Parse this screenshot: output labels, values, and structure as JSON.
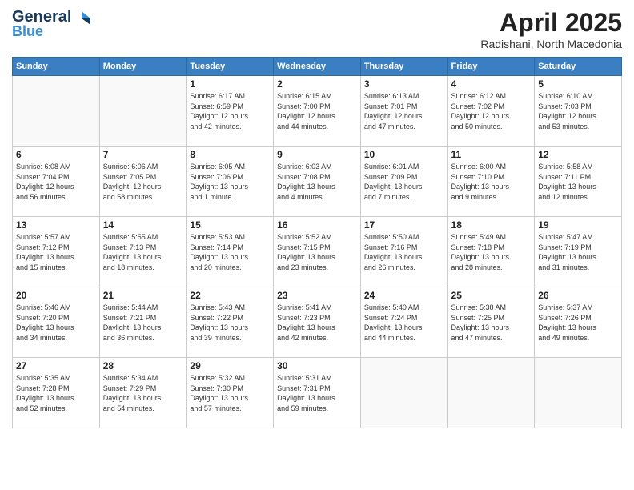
{
  "header": {
    "logo_general": "General",
    "logo_blue": "Blue",
    "month_title": "April 2025",
    "location": "Radishani, North Macedonia"
  },
  "weekdays": [
    "Sunday",
    "Monday",
    "Tuesday",
    "Wednesday",
    "Thursday",
    "Friday",
    "Saturday"
  ],
  "weeks": [
    [
      {
        "day": "",
        "info": ""
      },
      {
        "day": "",
        "info": ""
      },
      {
        "day": "1",
        "info": "Sunrise: 6:17 AM\nSunset: 6:59 PM\nDaylight: 12 hours\nand 42 minutes."
      },
      {
        "day": "2",
        "info": "Sunrise: 6:15 AM\nSunset: 7:00 PM\nDaylight: 12 hours\nand 44 minutes."
      },
      {
        "day": "3",
        "info": "Sunrise: 6:13 AM\nSunset: 7:01 PM\nDaylight: 12 hours\nand 47 minutes."
      },
      {
        "day": "4",
        "info": "Sunrise: 6:12 AM\nSunset: 7:02 PM\nDaylight: 12 hours\nand 50 minutes."
      },
      {
        "day": "5",
        "info": "Sunrise: 6:10 AM\nSunset: 7:03 PM\nDaylight: 12 hours\nand 53 minutes."
      }
    ],
    [
      {
        "day": "6",
        "info": "Sunrise: 6:08 AM\nSunset: 7:04 PM\nDaylight: 12 hours\nand 56 minutes."
      },
      {
        "day": "7",
        "info": "Sunrise: 6:06 AM\nSunset: 7:05 PM\nDaylight: 12 hours\nand 58 minutes."
      },
      {
        "day": "8",
        "info": "Sunrise: 6:05 AM\nSunset: 7:06 PM\nDaylight: 13 hours\nand 1 minute."
      },
      {
        "day": "9",
        "info": "Sunrise: 6:03 AM\nSunset: 7:08 PM\nDaylight: 13 hours\nand 4 minutes."
      },
      {
        "day": "10",
        "info": "Sunrise: 6:01 AM\nSunset: 7:09 PM\nDaylight: 13 hours\nand 7 minutes."
      },
      {
        "day": "11",
        "info": "Sunrise: 6:00 AM\nSunset: 7:10 PM\nDaylight: 13 hours\nand 9 minutes."
      },
      {
        "day": "12",
        "info": "Sunrise: 5:58 AM\nSunset: 7:11 PM\nDaylight: 13 hours\nand 12 minutes."
      }
    ],
    [
      {
        "day": "13",
        "info": "Sunrise: 5:57 AM\nSunset: 7:12 PM\nDaylight: 13 hours\nand 15 minutes."
      },
      {
        "day": "14",
        "info": "Sunrise: 5:55 AM\nSunset: 7:13 PM\nDaylight: 13 hours\nand 18 minutes."
      },
      {
        "day": "15",
        "info": "Sunrise: 5:53 AM\nSunset: 7:14 PM\nDaylight: 13 hours\nand 20 minutes."
      },
      {
        "day": "16",
        "info": "Sunrise: 5:52 AM\nSunset: 7:15 PM\nDaylight: 13 hours\nand 23 minutes."
      },
      {
        "day": "17",
        "info": "Sunrise: 5:50 AM\nSunset: 7:16 PM\nDaylight: 13 hours\nand 26 minutes."
      },
      {
        "day": "18",
        "info": "Sunrise: 5:49 AM\nSunset: 7:18 PM\nDaylight: 13 hours\nand 28 minutes."
      },
      {
        "day": "19",
        "info": "Sunrise: 5:47 AM\nSunset: 7:19 PM\nDaylight: 13 hours\nand 31 minutes."
      }
    ],
    [
      {
        "day": "20",
        "info": "Sunrise: 5:46 AM\nSunset: 7:20 PM\nDaylight: 13 hours\nand 34 minutes."
      },
      {
        "day": "21",
        "info": "Sunrise: 5:44 AM\nSunset: 7:21 PM\nDaylight: 13 hours\nand 36 minutes."
      },
      {
        "day": "22",
        "info": "Sunrise: 5:43 AM\nSunset: 7:22 PM\nDaylight: 13 hours\nand 39 minutes."
      },
      {
        "day": "23",
        "info": "Sunrise: 5:41 AM\nSunset: 7:23 PM\nDaylight: 13 hours\nand 42 minutes."
      },
      {
        "day": "24",
        "info": "Sunrise: 5:40 AM\nSunset: 7:24 PM\nDaylight: 13 hours\nand 44 minutes."
      },
      {
        "day": "25",
        "info": "Sunrise: 5:38 AM\nSunset: 7:25 PM\nDaylight: 13 hours\nand 47 minutes."
      },
      {
        "day": "26",
        "info": "Sunrise: 5:37 AM\nSunset: 7:26 PM\nDaylight: 13 hours\nand 49 minutes."
      }
    ],
    [
      {
        "day": "27",
        "info": "Sunrise: 5:35 AM\nSunset: 7:28 PM\nDaylight: 13 hours\nand 52 minutes."
      },
      {
        "day": "28",
        "info": "Sunrise: 5:34 AM\nSunset: 7:29 PM\nDaylight: 13 hours\nand 54 minutes."
      },
      {
        "day": "29",
        "info": "Sunrise: 5:32 AM\nSunset: 7:30 PM\nDaylight: 13 hours\nand 57 minutes."
      },
      {
        "day": "30",
        "info": "Sunrise: 5:31 AM\nSunset: 7:31 PM\nDaylight: 13 hours\nand 59 minutes."
      },
      {
        "day": "",
        "info": ""
      },
      {
        "day": "",
        "info": ""
      },
      {
        "day": "",
        "info": ""
      }
    ]
  ]
}
